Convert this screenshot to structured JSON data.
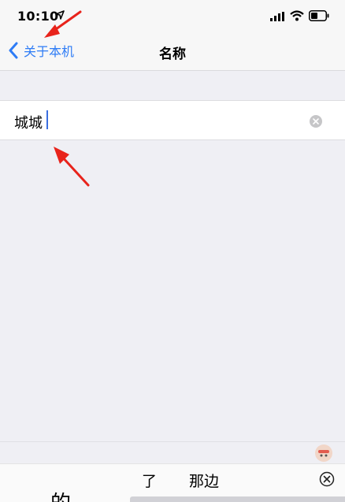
{
  "status_bar": {
    "time": "10:10"
  },
  "nav": {
    "back_label": "关于本机",
    "title": "名称"
  },
  "name_field": {
    "value": "城城"
  },
  "keyboard": {
    "candidate_main": "的",
    "candidates": [
      "了",
      "那边"
    ]
  },
  "colors": {
    "accent": "#2e7cf6",
    "annotation": "#e8231b"
  }
}
